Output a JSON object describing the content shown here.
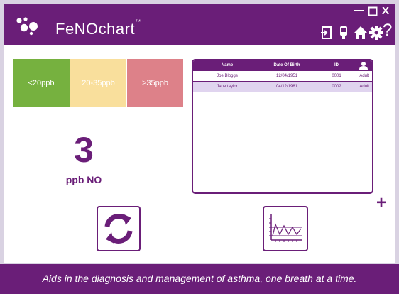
{
  "app": {
    "brand": "FeNOchart",
    "trademark": "™",
    "colors": {
      "primary": "#6a1e78",
      "background": "#d9d2e2",
      "low": "#76b13f",
      "mid": "#f9df9c",
      "high": "#dd8189"
    }
  },
  "window_controls": {
    "minimize_icon": "minus",
    "maximize_icon": "square",
    "close_label": "X"
  },
  "header_icons": [
    "exit-icon",
    "device-icon",
    "home-icon",
    "gear-icon"
  ],
  "help_label": "?",
  "ranges": [
    {
      "label": "<20ppb",
      "level": "low"
    },
    {
      "label": "20-35ppb",
      "level": "mid"
    },
    {
      "label": ">35ppb",
      "level": "high"
    }
  ],
  "reading": {
    "value": "3",
    "unit": "ppb NO"
  },
  "patients": {
    "columns": [
      "Name",
      "Date Of Birth",
      "ID"
    ],
    "rows": [
      {
        "name": "Joe Bloggs",
        "dob": "12/04/1951",
        "id": "0001",
        "type": "Adult"
      },
      {
        "name": "Jane taylor",
        "dob": "04/12/1981",
        "id": "0002",
        "type": "Adult"
      }
    ],
    "selected_row": 1
  },
  "add_label": "+",
  "footer": {
    "tagline": "Aids in the diagnosis and management of asthma, one breath at a time."
  }
}
